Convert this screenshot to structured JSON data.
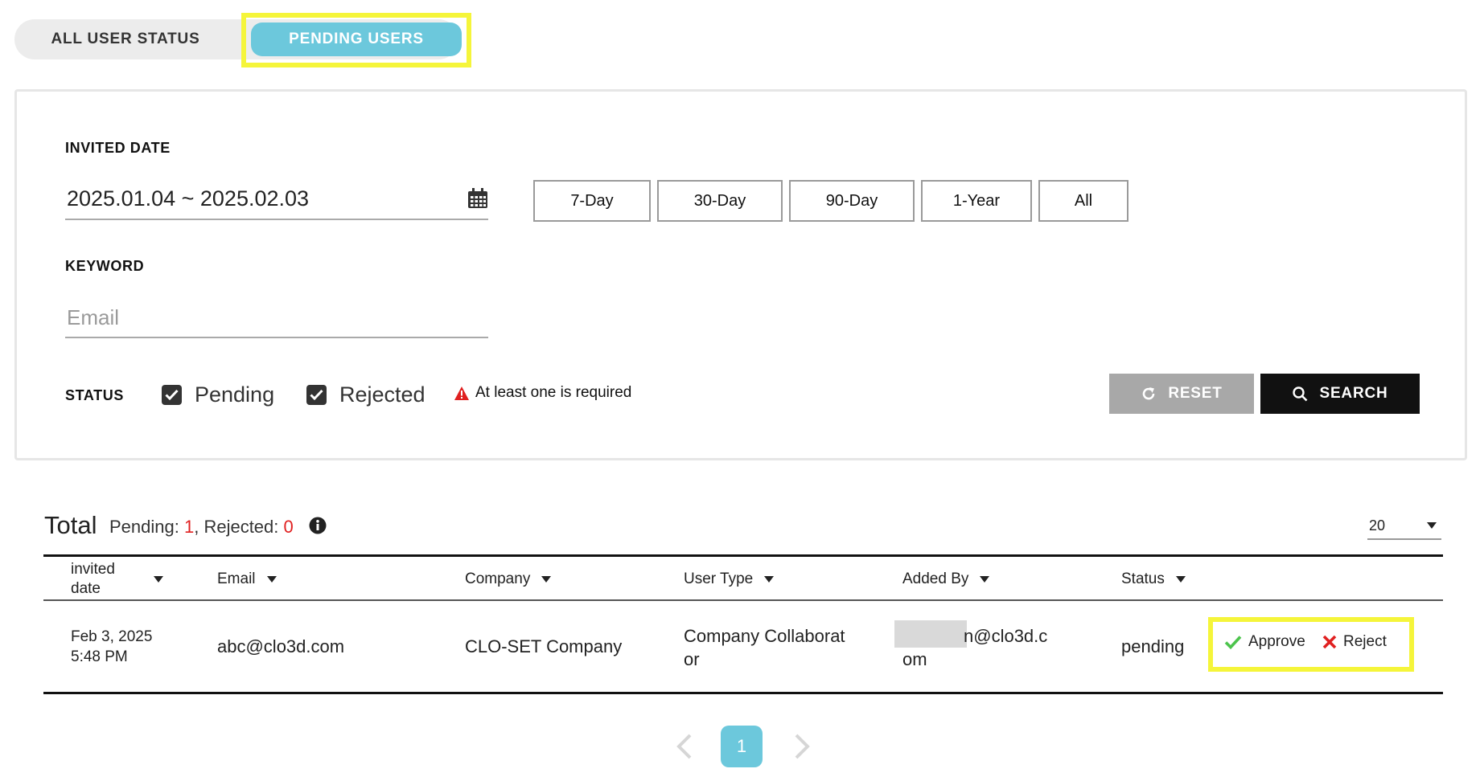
{
  "tabs": {
    "all_user_status": "ALL USER STATUS",
    "pending_users": "PENDING USERS"
  },
  "filters": {
    "invited_date_label": "INVITED DATE",
    "date_range": "2025.01.04 ~ 2025.02.03",
    "ranges": [
      "7-Day",
      "30-Day",
      "90-Day",
      "1-Year",
      "All"
    ],
    "keyword_label": "KEYWORD",
    "keyword_placeholder": "Email",
    "keyword_value": "",
    "status_label": "STATUS",
    "status_options": [
      {
        "label": "Pending",
        "checked": true
      },
      {
        "label": "Rejected",
        "checked": true
      }
    ],
    "warning": "At least one is required",
    "reset_label": "RESET",
    "search_label": "SEARCH"
  },
  "summary": {
    "title": "Total",
    "pending_label": "Pending: ",
    "pending_count": "1",
    "separator": ", Rejected: ",
    "rejected_count": "0",
    "page_size": "20"
  },
  "table": {
    "columns": [
      {
        "line1": "invited",
        "line2": "date"
      },
      {
        "line1": "Email",
        "line2": ""
      },
      {
        "line1": "Company",
        "line2": ""
      },
      {
        "line1": "User Type",
        "line2": ""
      },
      {
        "line1": "Added By",
        "line2": ""
      },
      {
        "line1": "Status",
        "line2": ""
      }
    ],
    "rows": [
      {
        "date_line1": "Feb 3, 2025",
        "date_line2": "5:48 PM",
        "email": "abc@clo3d.com",
        "company": "CLO-SET Company",
        "user_type_line1": "Company Collaborat",
        "user_type_line2": "or",
        "added_by_line1": "n@clo3d.c",
        "added_by_line2": "om",
        "status": "pending",
        "approve_label": "Approve",
        "reject_label": "Reject"
      }
    ]
  },
  "pagination": {
    "current_page": "1"
  },
  "colors": {
    "accent": "#6cc8dc",
    "highlight": "#f5f53a",
    "approve": "#4cc44c",
    "reject": "#e02020"
  }
}
